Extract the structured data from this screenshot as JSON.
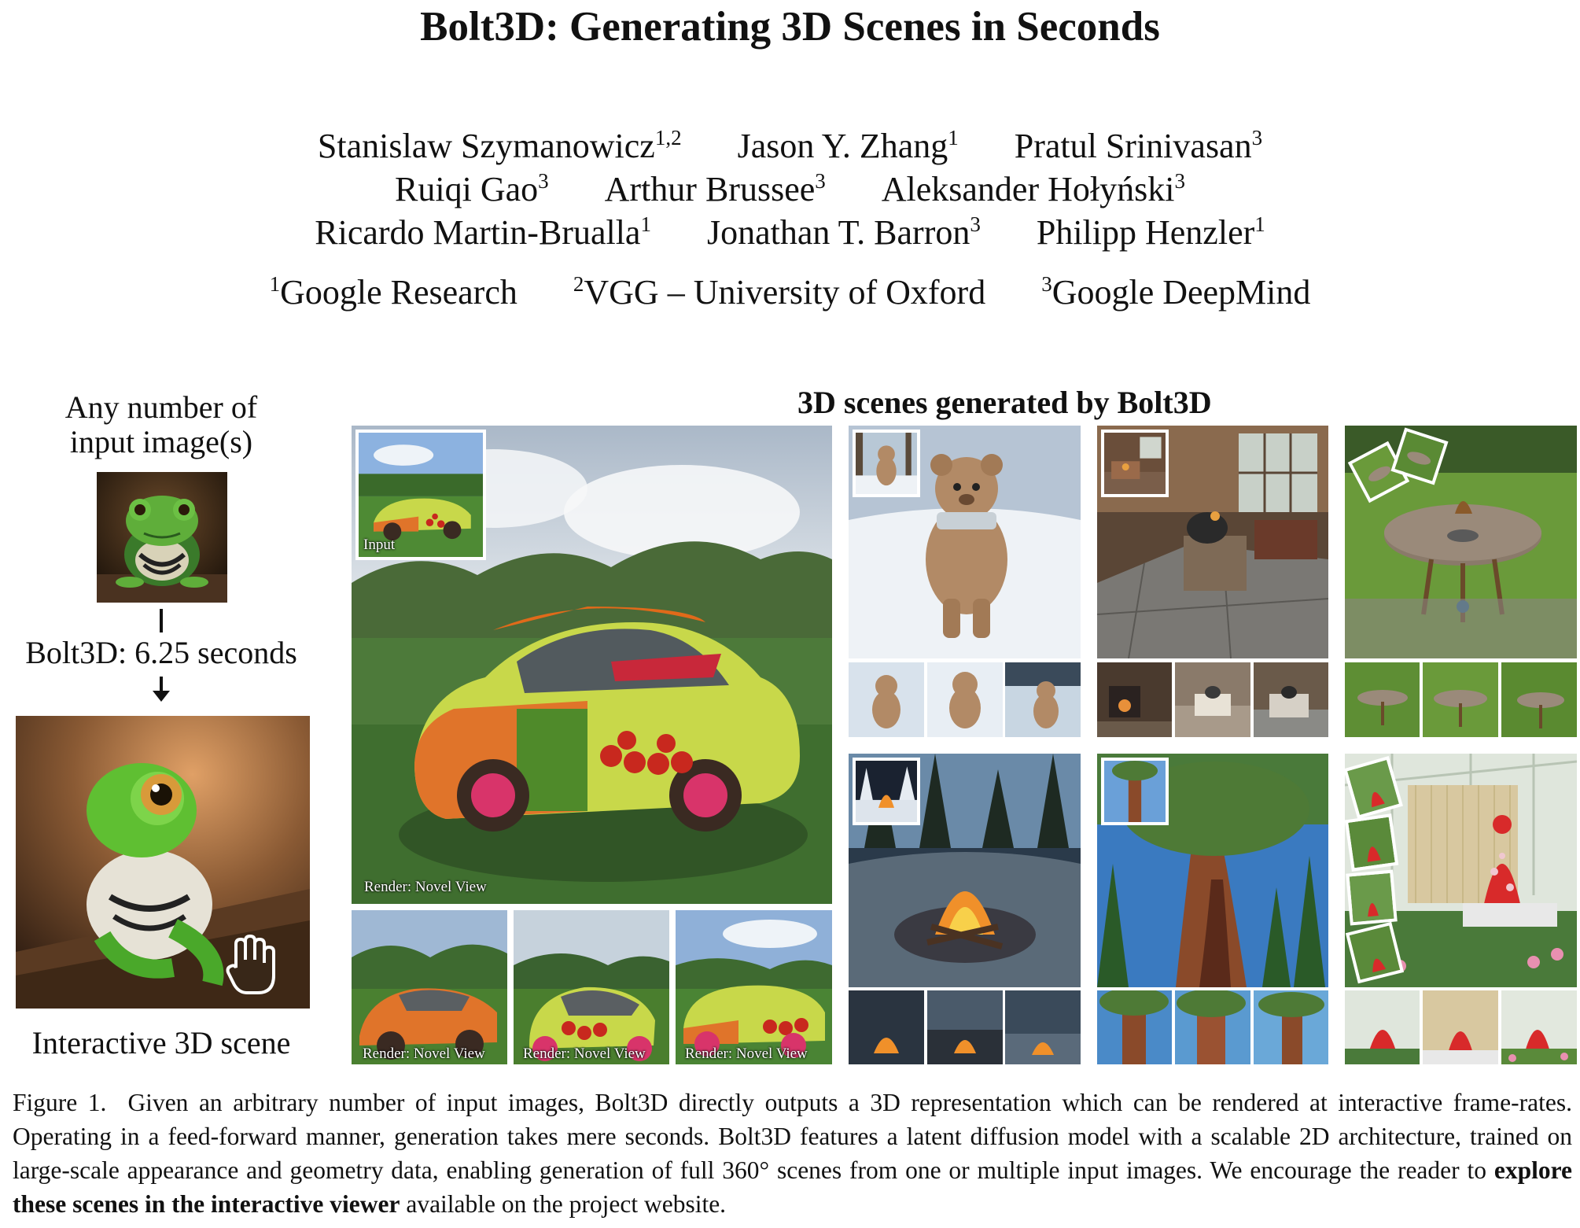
{
  "title": "Bolt3D: Generating 3D Scenes in Seconds",
  "authors": [
    [
      {
        "name": "Stanislaw Szymanowicz",
        "sup": "1,2"
      },
      {
        "name": "Jason Y. Zhang",
        "sup": "1"
      },
      {
        "name": "Pratul Srinivasan",
        "sup": "3"
      }
    ],
    [
      {
        "name": "Ruiqi Gao",
        "sup": "3"
      },
      {
        "name": "Arthur Brussee",
        "sup": "3"
      },
      {
        "name": "Aleksander Hołyński",
        "sup": "3"
      }
    ],
    [
      {
        "name": "Ricardo Martin-Brualla",
        "sup": "1"
      },
      {
        "name": "Jonathan T. Barron",
        "sup": "3"
      },
      {
        "name": "Philipp Henzler",
        "sup": "1"
      }
    ]
  ],
  "affiliations": [
    {
      "sup": "1",
      "name": "Google Research"
    },
    {
      "sup": "2",
      "name": "VGG – University of Oxford"
    },
    {
      "sup": "3",
      "name": "Google DeepMind"
    }
  ],
  "figure": {
    "left_panel": {
      "input_label_line1": "Any number of",
      "input_label_line2": "input image(s)",
      "timing_label": "Bolt3D: 6.25 seconds",
      "output_label": "Interactive 3D scene"
    },
    "section_title": "3D scenes generated by Bolt3D",
    "input_tag": "Input",
    "render_tag": "Render: Novel View"
  },
  "caption": {
    "prefix": "Figure 1.",
    "body": "Given an arbitrary number of input images, Bolt3D directly outputs a 3D representation which can be rendered at interactive frame-rates. Operating in a feed-forward manner, generation takes mere seconds. Bolt3D features a latent diffusion model with a scalable 2D architecture, trained on large-scale appearance and geometry data, enabling generation of full 360° scenes from one or multiple input images. We encourage the reader to ",
    "bold": "explore these scenes in the interactive viewer",
    "suffix": " available on the project website."
  }
}
